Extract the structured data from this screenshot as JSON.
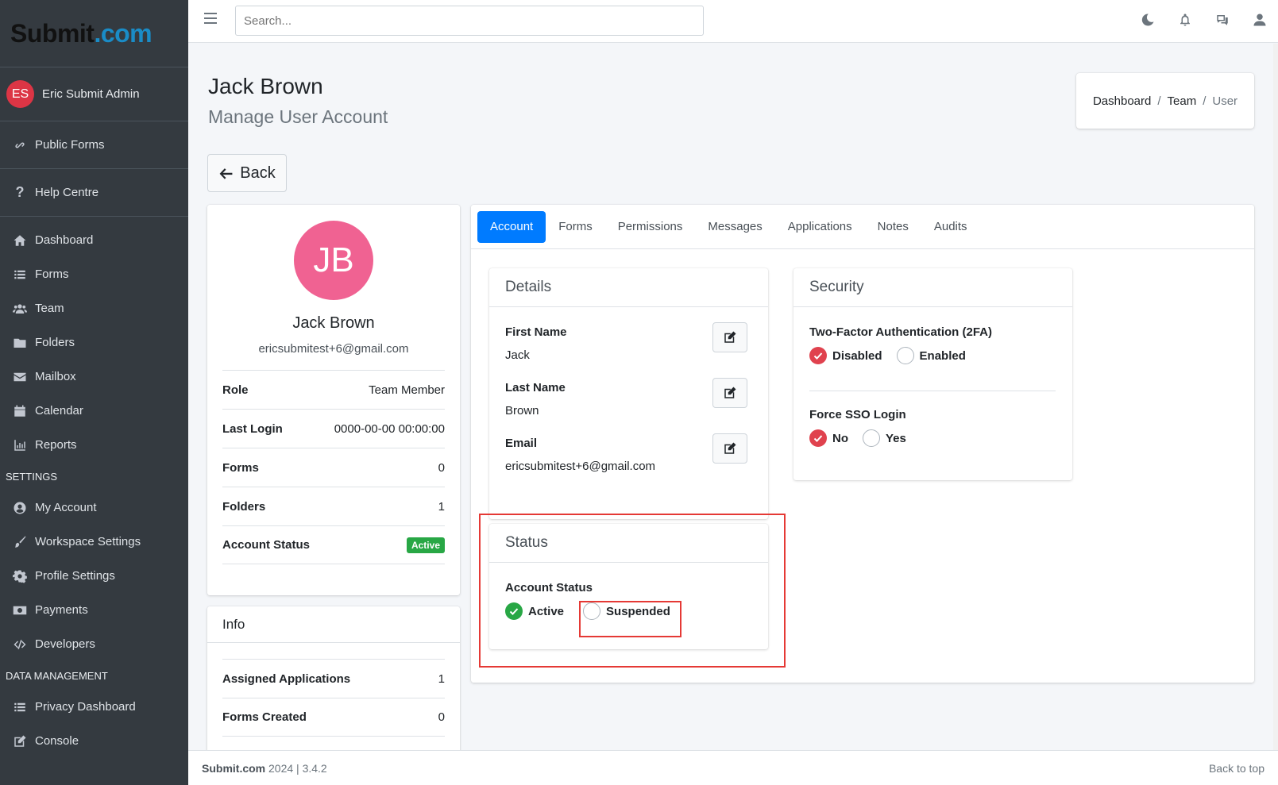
{
  "brand": {
    "part1": "Subm",
    "part2": "it",
    "part3": ".com"
  },
  "sidebar": {
    "user": {
      "initials": "ES",
      "name": "Eric Submit Admin"
    },
    "public_forms": "Public Forms",
    "help_centre": "Help Centre",
    "items": [
      {
        "label": "Dashboard",
        "icon": "home-icon"
      },
      {
        "label": "Forms",
        "icon": "list-icon"
      },
      {
        "label": "Team",
        "icon": "users-icon"
      },
      {
        "label": "Folders",
        "icon": "folder-icon"
      },
      {
        "label": "Mailbox",
        "icon": "envelope-icon"
      },
      {
        "label": "Calendar",
        "icon": "calendar-icon"
      },
      {
        "label": "Reports",
        "icon": "chart-icon"
      }
    ],
    "settings_header": "SETTINGS",
    "settings_items": [
      {
        "label": "My Account",
        "icon": "user-circle-icon"
      },
      {
        "label": "Workspace Settings",
        "icon": "brush-icon"
      },
      {
        "label": "Profile Settings",
        "icon": "gear-icon"
      },
      {
        "label": "Payments",
        "icon": "money-icon"
      },
      {
        "label": "Developers",
        "icon": "code-icon"
      }
    ],
    "data_header": "DATA MANAGEMENT",
    "data_items": [
      {
        "label": "Privacy Dashboard",
        "icon": "list-icon"
      },
      {
        "label": "Console",
        "icon": "edit-icon"
      }
    ]
  },
  "topbar": {
    "search_placeholder": "Search..."
  },
  "page": {
    "title": "Jack Brown",
    "subtitle": "Manage User Account",
    "back_label": "Back"
  },
  "breadcrumb": {
    "items": [
      "Dashboard",
      "Team",
      "User"
    ]
  },
  "profile": {
    "initials": "JB",
    "name": "Jack Brown",
    "email": "ericsubmitest+6@gmail.com",
    "rows": [
      {
        "key": "Role",
        "value": "Team Member"
      },
      {
        "key": "Last Login",
        "value": "0000-00-00 00:00:00"
      },
      {
        "key": "Forms",
        "value": "0"
      },
      {
        "key": "Folders",
        "value": "1"
      },
      {
        "key": "Account Status",
        "value": "Active"
      }
    ],
    "avatar_color": "#f06292"
  },
  "info": {
    "title": "Info",
    "rows": [
      {
        "key": "Assigned Applications",
        "value": "1"
      },
      {
        "key": "Forms Created",
        "value": "0"
      }
    ]
  },
  "tabs": [
    "Account",
    "Forms",
    "Permissions",
    "Messages",
    "Applications",
    "Notes",
    "Audits"
  ],
  "details": {
    "title": "Details",
    "fields": [
      {
        "label": "First Name",
        "value": "Jack"
      },
      {
        "label": "Last Name",
        "value": "Brown"
      },
      {
        "label": "Email",
        "value": "ericsubmitest+6@gmail.com"
      }
    ]
  },
  "security": {
    "title": "Security",
    "twofa_label": "Two-Factor Authentication (2FA)",
    "twofa_options": [
      "Disabled",
      "Enabled"
    ],
    "twofa_selected": "Disabled",
    "sso_label": "Force SSO Login",
    "sso_options": [
      "No",
      "Yes"
    ],
    "sso_selected": "No"
  },
  "status": {
    "title": "Status",
    "label": "Account Status",
    "options": [
      "Active",
      "Suspended"
    ],
    "selected": "Active"
  },
  "footer": {
    "brand": "Submit.com",
    "year_version": "2024 | 3.4.2",
    "back_to_top": "Back to top"
  },
  "colors": {
    "accent": "#007bff",
    "sidebar_bg": "#343a40",
    "active_badge": "#28a745",
    "highlight": "#e53935"
  }
}
